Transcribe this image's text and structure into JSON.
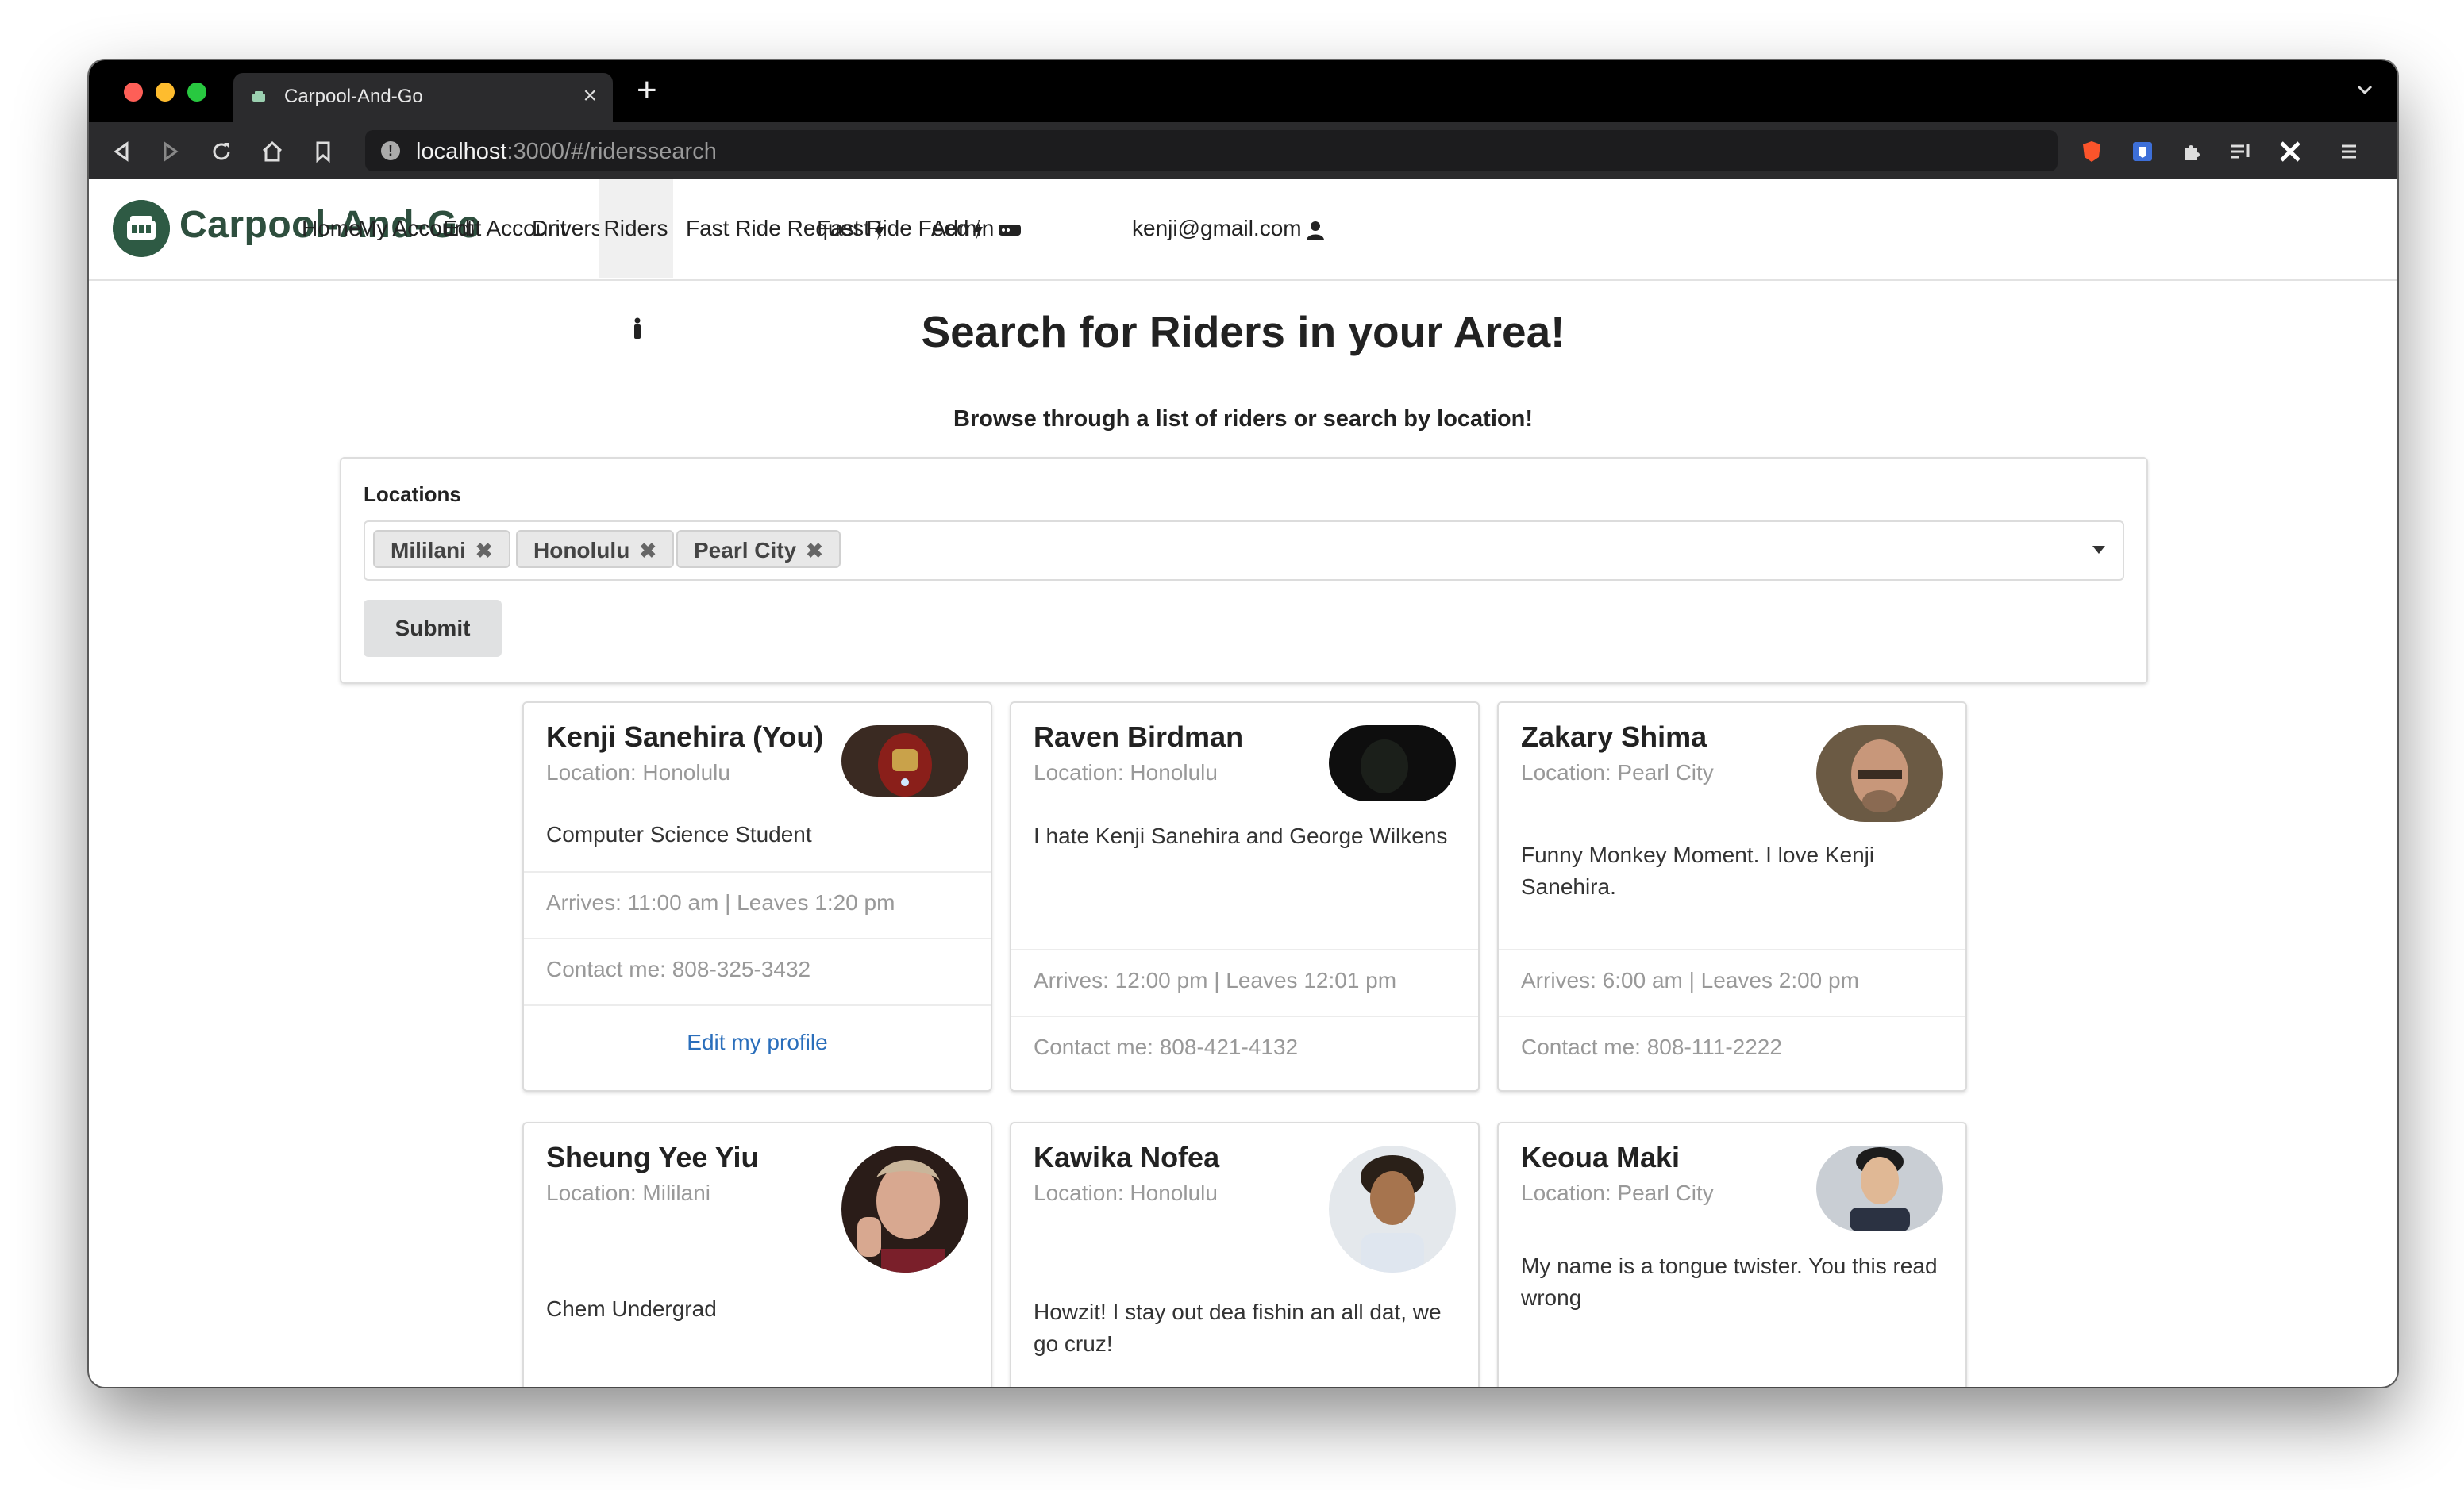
{
  "browser": {
    "tab_title": "Carpool-And-Go",
    "url_host": "localhost",
    "url_path": ":3000/#/riderssearch"
  },
  "navbar": {
    "brand": "Carpool-And-Go",
    "items": [
      {
        "label": "Home"
      },
      {
        "label": "My Account"
      },
      {
        "label": "Edit Account"
      },
      {
        "label": "Drivers"
      },
      {
        "label": "Riders"
      },
      {
        "label": "Fast Ride Request"
      },
      {
        "label": "Fast Ride Feed"
      },
      {
        "label": "Admin"
      }
    ],
    "user_email": "kenji@gmail.com"
  },
  "page": {
    "title": "Search for Riders in your Area!",
    "subtitle": "Browse through a list of riders or search by location!"
  },
  "form": {
    "locations_label": "Locations",
    "selected": [
      "Mililani",
      "Honolulu",
      "Pearl City"
    ],
    "submit_label": "Submit"
  },
  "riders": [
    {
      "name": "Kenji Sanehira (You)",
      "location": "Location: Honolulu",
      "description": "Computer Science Student",
      "schedule": "Arrives: 11:00 am | Leaves 1:20 pm",
      "contact": "Contact me: 808-325-3432",
      "edit_link": "Edit my profile"
    },
    {
      "name": "Raven Birdman",
      "location": "Location: Honolulu",
      "description": "I hate Kenji Sanehira and George Wilkens",
      "schedule": "Arrives: 12:00 pm | Leaves 12:01 pm",
      "contact": "Contact me: 808-421-4132"
    },
    {
      "name": "Zakary Shima",
      "location": "Location: Pearl City",
      "description": "Funny Monkey Moment. I love Kenji Sanehira.",
      "schedule": "Arrives: 6:00 am | Leaves 2:00 pm",
      "contact": "Contact me: 808-111-2222"
    },
    {
      "name": "Sheung Yee Yiu",
      "location": "Location: Mililani",
      "description": "Chem Undergrad"
    },
    {
      "name": "Kawika Nofea",
      "location": "Location: Honolulu",
      "description": "Howzit! I stay out dea fishin an all dat, we go cruz!"
    },
    {
      "name": "Keoua Maki",
      "location": "Location: Pearl City",
      "description": "My name is a tongue twister. You this read wrong"
    }
  ]
}
